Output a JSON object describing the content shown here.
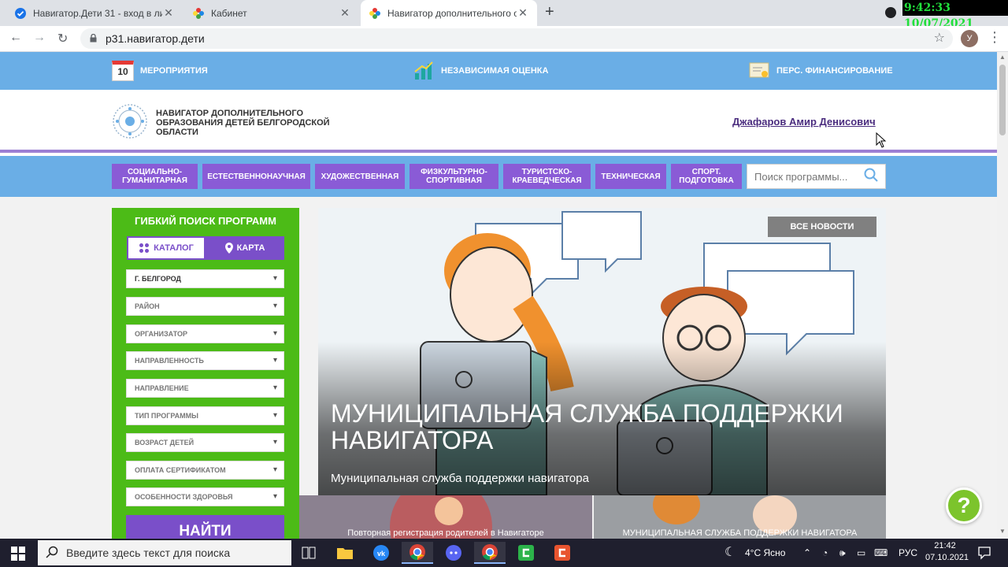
{
  "browser": {
    "tabs": [
      {
        "title": "Навигатор.Дети 31 - вход в лич",
        "active": false
      },
      {
        "title": "Кабинет",
        "active": false
      },
      {
        "title": "Навигатор дополнительного об",
        "active": true
      }
    ],
    "url": "р31.навигатор.дети",
    "avatar_letter": "У",
    "overlay_clock": "9:42:33  10/07/2021"
  },
  "topbar": {
    "calendar_day": "10",
    "events": "Мероприятия",
    "assessment": "Независимая оценка",
    "financing": "Перс. финансирование"
  },
  "header": {
    "logo_text": "Навигатор дополнительного образования детей Белгородской области",
    "user_name": "Джафаров Амир Денисович"
  },
  "categories": [
    "Социально-гуманитарная",
    "Естественнонаучная",
    "Художественная",
    "Физкультурно-спортивная",
    "Туристско-краеведческая",
    "Техническая",
    "Спорт. подготовка"
  ],
  "search": {
    "placeholder": "Поиск программы..."
  },
  "filter": {
    "title": "Гибкий поиск программ",
    "catalog": "Каталог",
    "map": "Карта",
    "selects": [
      "г. Белгород",
      "Район",
      "Организатор",
      "Направленность",
      "Направление",
      "Тип программы",
      "Возраст детей",
      "Оплата сертификатом",
      "Особенности здоровья"
    ],
    "find": "Найти"
  },
  "banner": {
    "all_news": "Все новости",
    "title": "Муниципальная служба поддержки навигатора",
    "subtitle": "Муниципальная служба поддержки навигатора"
  },
  "thumbs": [
    "Повторная регистрация родителей в Навигаторе",
    "МУНИЦИПАЛЬНАЯ СЛУЖБА ПОДДЕРЖКИ НАВИГАТОРА"
  ],
  "help": "?",
  "taskbar": {
    "search_placeholder": "Введите здесь текст для поиска",
    "weather": "4°C  Ясно",
    "lang": "РУС",
    "time": "21:42",
    "date": "07.10.2021"
  },
  "colors": {
    "topbar_blue": "#6aaee6",
    "purple": "#8a5bd6",
    "green": "#4cbb17"
  }
}
